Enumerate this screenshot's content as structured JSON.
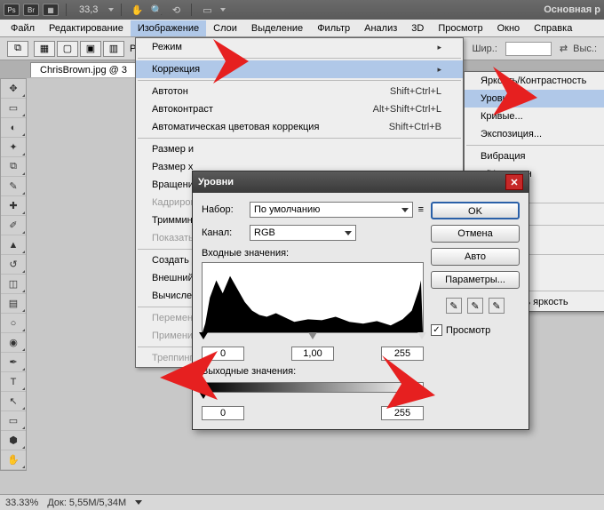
{
  "winbar": {
    "zoom": "33,3",
    "right": "Основная р"
  },
  "menubar": [
    "Файл",
    "Редактирование",
    "Изображение",
    "Слои",
    "Выделение",
    "Фильтр",
    "Анализ",
    "3D",
    "Просмотр",
    "Окно",
    "Справка"
  ],
  "optbar": {
    "ra": "Ра",
    "w": "Шир.:",
    "h": "Выс.:"
  },
  "doctab": "ChrisBrown.jpg @ 3",
  "ddImage": {
    "mode": "Режим",
    "correction": "Коррекция",
    "autotone": {
      "label": "Автотон",
      "sc": "Shift+Ctrl+L"
    },
    "autocontrast": {
      "label": "Автоконтраст",
      "sc": "Alt+Shift+Ctrl+L"
    },
    "autocolor": {
      "label": "Автоматическая цветовая коррекция",
      "sc": "Shift+Ctrl+B"
    },
    "imgsize": "Размер и",
    "canvsize": "Размер х",
    "rotate": "Вращени",
    "crop": "Кадриров",
    "trim": "Триммин",
    "reveal": "Показать",
    "dup": "Создать д",
    "apply": "Внешний",
    "calc": "Вычислен",
    "vars": "Перемен",
    "applyds": "Примени",
    "trap": "Треппинг"
  },
  "ddCorrect": {
    "brightcontrast": "Яркость/Контрастность",
    "levels": "Уровни...",
    "curves": "Кривые...",
    "exposure": "Экспозиция...",
    "vibrance": "Вибрация",
    "huesat": "н/Насыщен",
    "colorbalance": "анс...",
    "channels": "е каналов",
    "ента...": "ента...",
    "коррекци": "коррекци",
    "invert": "вет",
    "е...": "е...",
    "ь...": "ь...",
    "equalize": "Выровнять яркость"
  },
  "dialog": {
    "title": "Уровни",
    "preset_lbl": "Набор:",
    "preset_val": "По умолчанию",
    "channel_lbl": "Канал:",
    "channel_val": "RGB",
    "input_lbl": "Входные значения:",
    "in_black": "0",
    "in_mid": "1,00",
    "in_white": "255",
    "output_lbl": "Выходные значения:",
    "out_black": "0",
    "out_white": "255",
    "ok": "OK",
    "cancel": "Отмена",
    "auto": "Авто",
    "params": "Параметры...",
    "preview": "Просмотр"
  },
  "status": {
    "zoom": "33.33%",
    "doc": "Док: 5,55M/5,34M"
  }
}
